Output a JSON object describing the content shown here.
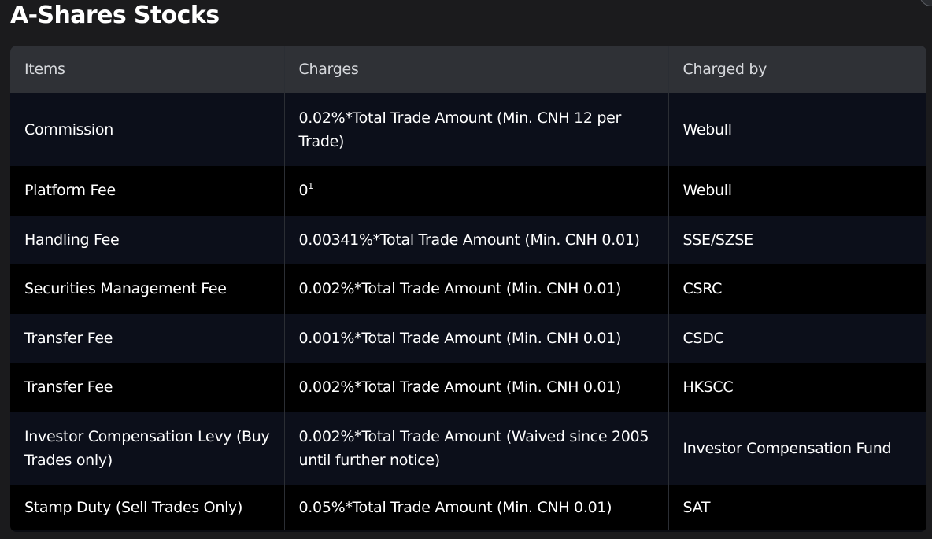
{
  "page": {
    "title": "A-Shares Stocks"
  },
  "table": {
    "headers": [
      "Items",
      "Charges",
      "Charged by"
    ],
    "rows": [
      {
        "item": "Commission",
        "charge": "0.02%*Total Trade Amount (Min. CNH 12 per Trade)",
        "charged_by": "Webull"
      },
      {
        "item": "Platform Fee",
        "charge": "0",
        "charge_footnote": "1",
        "charged_by": "Webull"
      },
      {
        "item": "Handling Fee",
        "charge": "0.00341%*Total Trade Amount (Min. CNH 0.01)",
        "charged_by": "SSE/SZSE"
      },
      {
        "item": "Securities Management Fee",
        "charge": "0.002%*Total Trade Amount (Min. CNH 0.01)",
        "charged_by": "CSRC"
      },
      {
        "item": "Transfer Fee",
        "charge": "0.001%*Total Trade Amount (Min. CNH 0.01)",
        "charged_by": "CSDC"
      },
      {
        "item": "Transfer Fee",
        "charge": "0.002%*Total Trade Amount (Min. CNH 0.01)",
        "charged_by": "HKSCC"
      },
      {
        "item": "Investor Compensation Levy (Buy Trades only)",
        "charge": "0.002%*Total Trade Amount (Waived since 2005 until further notice)",
        "charged_by": "Investor Compensation Fund"
      },
      {
        "item": "Stamp Duty (Sell Trades Only)",
        "charge": "0.05%*Total Trade Amount (Min. CNH 0.01)",
        "charged_by": "SAT"
      }
    ]
  },
  "colors": {
    "page_background": "#1b1b1d",
    "header_background": "#2f3136",
    "row_odd_background": "#0c0f1a",
    "row_even_background": "#000000",
    "text": "#ffffff"
  },
  "icons": {
    "corner_button": "close-icon"
  }
}
